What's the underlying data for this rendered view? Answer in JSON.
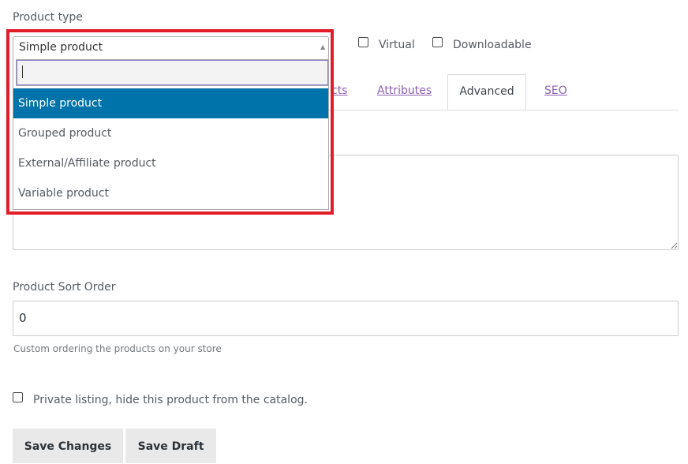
{
  "product_type": {
    "label": "Product type",
    "selected": "Simple product",
    "search_value": "",
    "options": [
      "Simple product",
      "Grouped product",
      "External/Affiliate product",
      "Variable product"
    ]
  },
  "checkboxes": {
    "virtual": "Virtual",
    "downloadable": "Downloadable"
  },
  "tabs": {
    "partial": "cts",
    "attributes": "Attributes",
    "advanced": "Advanced",
    "seo": "SEO"
  },
  "sort_order": {
    "label": "Product Sort Order",
    "value": "0",
    "help": "Custom ordering the products on your store"
  },
  "private_listing": {
    "label": "Private listing, hide this product from the catalog."
  },
  "buttons": {
    "save_changes": "Save Changes",
    "save_draft": "Save Draft"
  },
  "colors": {
    "highlight": "#e11d2a",
    "selected_option": "#0073aa",
    "tab_link": "#8e5fb0"
  }
}
